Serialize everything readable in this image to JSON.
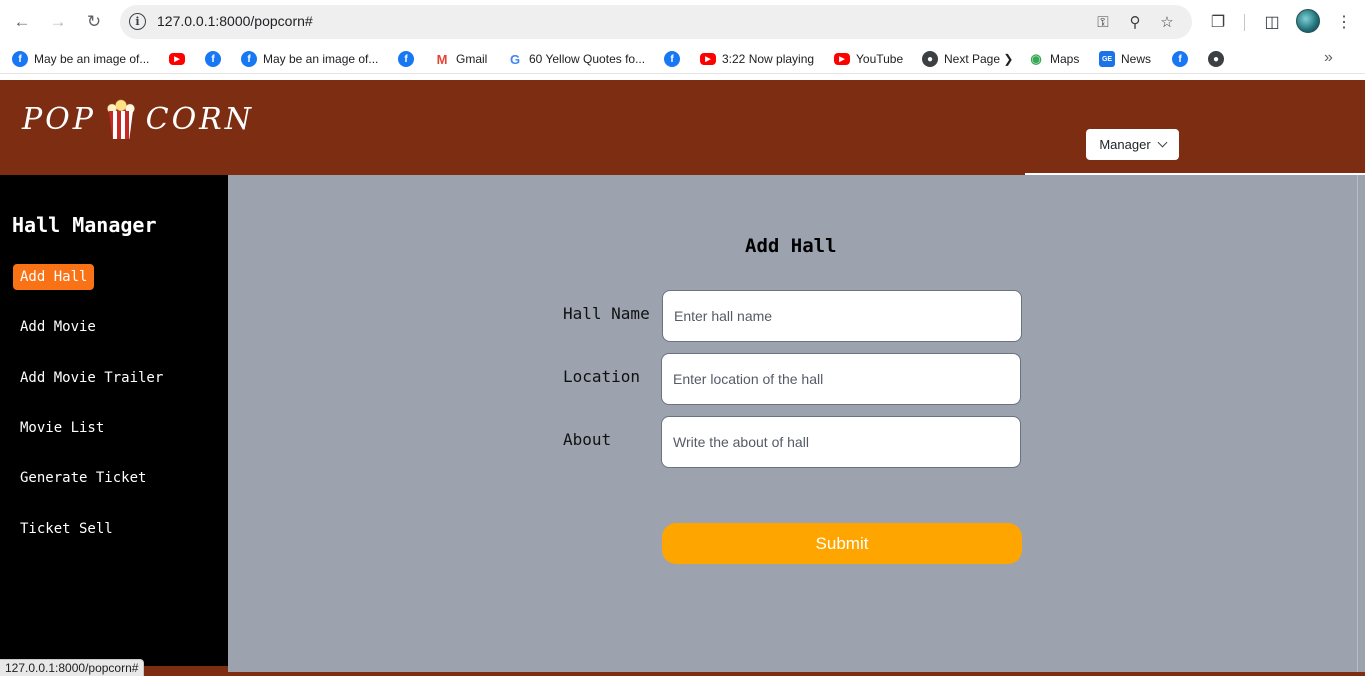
{
  "browser": {
    "url": "127.0.0.1:8000/popcorn#",
    "bookmarks": [
      {
        "label": "May be an image of...",
        "icon": "facebook-icon"
      },
      {
        "label": "",
        "icon": "youtube-icon"
      },
      {
        "label": "",
        "icon": "facebook-icon"
      },
      {
        "label": "May be an image of...",
        "icon": "facebook-icon"
      },
      {
        "label": "",
        "icon": "facebook-icon"
      },
      {
        "label": "Gmail",
        "icon": "gmail-icon"
      },
      {
        "label": "60 Yellow Quotes fo...",
        "icon": "google-icon"
      },
      {
        "label": "",
        "icon": "facebook-icon"
      },
      {
        "label": "3:22 Now playing",
        "icon": "youtube-icon"
      },
      {
        "label": "YouTube",
        "icon": "youtube-icon"
      },
      {
        "label": "Next Page ❯",
        "icon": "globe-icon"
      },
      {
        "label": "Maps",
        "icon": "maps-icon"
      },
      {
        "label": "News",
        "icon": "news-icon"
      },
      {
        "label": "",
        "icon": "facebook-icon"
      },
      {
        "label": "",
        "icon": "globe-icon"
      }
    ],
    "status_url": "127.0.0.1:8000/popcorn#"
  },
  "header": {
    "logo_left": "POP",
    "logo_right": "CORN",
    "user_menu_label": "Manager"
  },
  "sidebar": {
    "title": "Hall Manager",
    "items": [
      {
        "label": "Add Hall",
        "active": true
      },
      {
        "label": "Add Movie"
      },
      {
        "label": "Add Movie Trailer"
      },
      {
        "label": "Movie List"
      },
      {
        "label": "Generate Ticket"
      },
      {
        "label": "Ticket Sell"
      }
    ]
  },
  "form": {
    "title": "Add Hall",
    "fields": [
      {
        "label": "Hall Name",
        "placeholder": "Enter hall name",
        "value": ""
      },
      {
        "label": "Location",
        "placeholder": "Enter location of the hall",
        "value": ""
      },
      {
        "label": "About",
        "placeholder": "Write the about of hall",
        "value": ""
      }
    ],
    "submit_label": "Submit"
  },
  "colors": {
    "header_bg": "#7c2d12",
    "sidebar_bg": "#000000",
    "active_item": "#f97316",
    "main_bg": "#9ca3af",
    "submit_bg": "#ffa500"
  }
}
